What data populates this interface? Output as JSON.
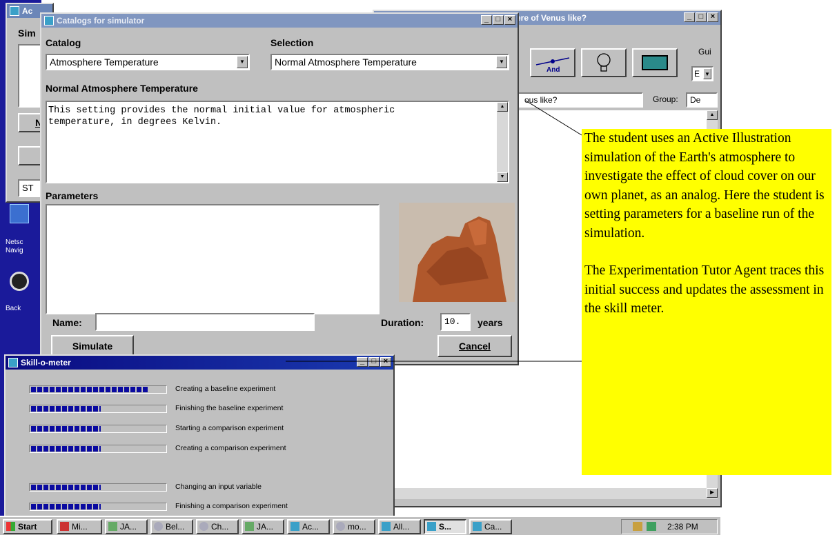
{
  "catalogs_window": {
    "title": "Catalogs for simulator",
    "catalog_label": "Catalog",
    "catalog_value": "Atmosphere Temperature",
    "selection_label": "Selection",
    "selection_value": "Normal Atmosphere Temperature",
    "description_heading": "Normal Atmosphere Temperature",
    "description_text": "This setting provides the normal initial value for atmospheric\ntemperature, in degrees Kelvin.",
    "parameters_label": "Parameters",
    "name_label": "Name:",
    "name_value": "",
    "duration_label": "Duration:",
    "duration_value": "10.",
    "duration_unit": "years",
    "simulate_button": "Simulate",
    "cancel_button": "Cancel"
  },
  "back_window": {
    "title": "ere of Venus like?",
    "toolbar_and_label": "And",
    "gui_label": "Gui",
    "combo_value": "E",
    "question_text": "ous like?",
    "group_label": "Group:",
    "group_value": "De"
  },
  "left_window": {
    "title": "Ac",
    "sim_label": "Sim",
    "n_button": "N",
    "st_label": "ST"
  },
  "desktop": {
    "icons": [
      {
        "label": "Netsc Navig"
      },
      {
        "label": "Back"
      }
    ]
  },
  "skill_meter": {
    "title": "Skill-o-meter",
    "skills": [
      {
        "label": "Creating a baseline experiment",
        "level": 0.88
      },
      {
        "label": "Finishing the baseline experiment",
        "level": 0.52
      },
      {
        "label": "Starting a comparison experiment",
        "level": 0.52
      },
      {
        "label": "Creating a comparison experiment",
        "level": 0.52
      },
      {
        "label": "Changing an input variable",
        "level": 0.52
      },
      {
        "label": "Finishing a comparison experiment",
        "level": 0.52
      }
    ]
  },
  "callout": {
    "paragraph1": "The student uses an Active Illustration simulation of the Earth's atmosphere to investigate the effect of cloud cover on our own planet, as an analog.  Here the student is setting parameters for a baseline run of the simulation.",
    "paragraph2": "The Experimentation Tutor Agent traces this initial success and updates the assessment in the skill meter."
  },
  "taskbar": {
    "start_label": "Start",
    "tasks": [
      "Mi...",
      "JA...",
      "Bel...",
      "Ch...",
      "JA...",
      "Ac...",
      "mo...",
      "All...",
      "S...",
      "Ca..."
    ],
    "clock": "2:38 PM"
  },
  "colors": {
    "title_active": "#0a0a80",
    "callout_background": "#ffff00",
    "skill_bar": "#0a0aa0",
    "desktop": "#1a1a9a"
  }
}
